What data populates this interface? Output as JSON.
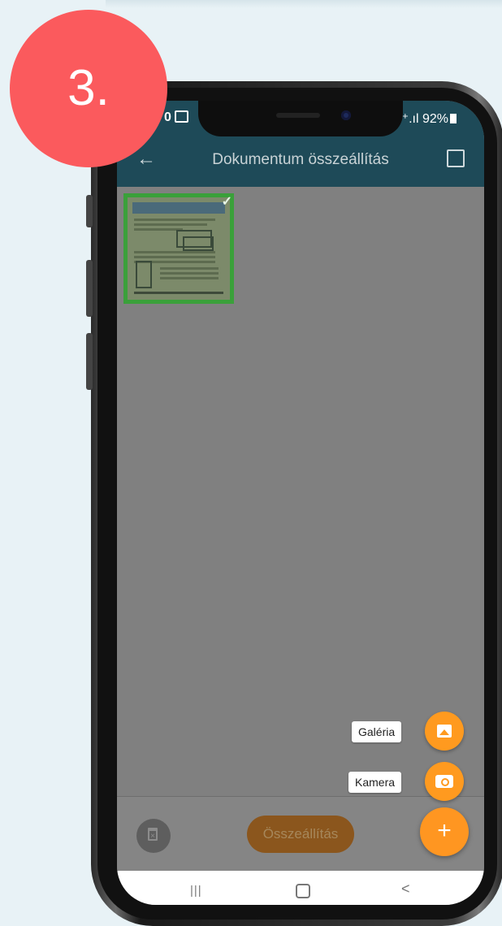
{
  "step": {
    "number": "3."
  },
  "status_bar": {
    "time_fragment": "0",
    "signal_battery": "⁺.ıl 92%"
  },
  "app_bar": {
    "title": "Dokumentum összeállítás"
  },
  "pages": [
    {
      "selected": true
    }
  ],
  "bottom_bar": {
    "assemble_label": "Összeállítás"
  },
  "speed_dial": {
    "gallery_label": "Galéria",
    "camera_label": "Kamera",
    "main_symbol": "+"
  },
  "nav_bar": {
    "recent_symbol": "|||",
    "back_symbol": "<"
  },
  "colors": {
    "accent": "#ff9621",
    "step_badge": "#fb5a5d",
    "appbar": "#1e4a58"
  }
}
